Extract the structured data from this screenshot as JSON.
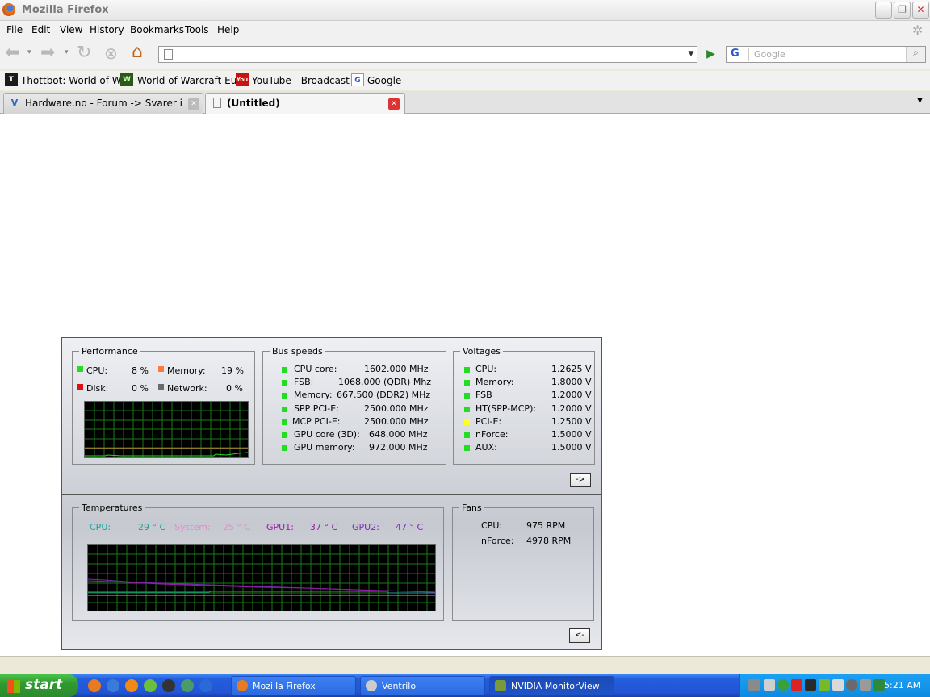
{
  "window": {
    "title": "Mozilla Firefox"
  },
  "menu": [
    "File",
    "Edit",
    "View",
    "History",
    "Bookmarks",
    "Tools",
    "Help"
  ],
  "search": {
    "placeholder": "Google",
    "engine": "G"
  },
  "bookmarks": [
    {
      "label": "Thottbot: World of W...",
      "icon": "thottbot-icon"
    },
    {
      "label": "World of Warcraft Eu...",
      "icon": "wow-icon"
    },
    {
      "label": "YouTube - Broadcast ...",
      "icon": "youtube-icon"
    },
    {
      "label": "Google",
      "icon": "google-icon"
    }
  ],
  "tabs": [
    {
      "label": "Hardware.no - Forum -> Svarer i Spør...",
      "active": false
    },
    {
      "label": "(Untitled)",
      "active": true
    }
  ],
  "monitor": {
    "performance": {
      "title": "Performance",
      "cpu": {
        "label": "CPU:",
        "value": "8 %"
      },
      "memory": {
        "label": "Memory:",
        "value": "19 %"
      },
      "disk": {
        "label": "Disk:",
        "value": "0 %"
      },
      "network": {
        "label": "Network:",
        "value": "0 %"
      }
    },
    "bus": {
      "title": "Bus speeds",
      "items": [
        {
          "label": "CPU core:",
          "value": "1602.000 MHz"
        },
        {
          "label": "FSB:",
          "value": "1068.000 (QDR) Mhz"
        },
        {
          "label": "Memory:",
          "value": "667.500  (DDR2) MHz"
        },
        {
          "label": "SPP PCI-E:",
          "value": "2500.000 MHz"
        },
        {
          "label": "MCP PCI-E:",
          "value": "2500.000 MHz"
        },
        {
          "label": "GPU core (3D):",
          "value": "648.000 MHz"
        },
        {
          "label": "GPU memory:",
          "value": "972.000 MHz"
        }
      ]
    },
    "voltages": {
      "title": "Voltages",
      "items": [
        {
          "label": "CPU:",
          "value": "1.2625 V",
          "color": "#22dd22"
        },
        {
          "label": "Memory:",
          "value": "1.8000 V",
          "color": "#22dd22"
        },
        {
          "label": "FSB",
          "value": "1.2000 V",
          "color": "#22dd22"
        },
        {
          "label": "HT(SPP-MCP):",
          "value": "1.2000 V",
          "color": "#22dd22"
        },
        {
          "label": "PCI-E:",
          "value": "1.2500 V",
          "color": "#ffff22"
        },
        {
          "label": "nForce:",
          "value": "1.5000 V",
          "color": "#22dd22"
        },
        {
          "label": "AUX:",
          "value": "1.5000 V",
          "color": "#22dd22"
        }
      ]
    },
    "expand_button": "->",
    "temperatures": {
      "title": "Temperatures",
      "cpu": {
        "label": "CPU:",
        "value": "29 ° C",
        "color": "#1aa0a0"
      },
      "system": {
        "label": "System:",
        "value": "25 ° C",
        "color": "#e48ad0"
      },
      "gpu1": {
        "label": "GPU1:",
        "value": "37 ° C",
        "color": "#9a1aa8"
      },
      "gpu2": {
        "label": "GPU2:",
        "value": "47 ° C",
        "color": "#7a2ab8"
      }
    },
    "fans": {
      "title": "Fans",
      "cpu": {
        "label": "CPU:",
        "value": "975 RPM"
      },
      "nforce": {
        "label": "nForce:",
        "value": "4978 RPM"
      }
    },
    "collapse_button": "<-"
  },
  "taskbar": {
    "start": "start",
    "windows": [
      {
        "label": "Mozilla Firefox",
        "active": false
      },
      {
        "label": "Ventrilo",
        "active": false
      },
      {
        "label": "NVIDIA MonitorView",
        "active": true
      }
    ],
    "clock": "5:21 AM"
  }
}
